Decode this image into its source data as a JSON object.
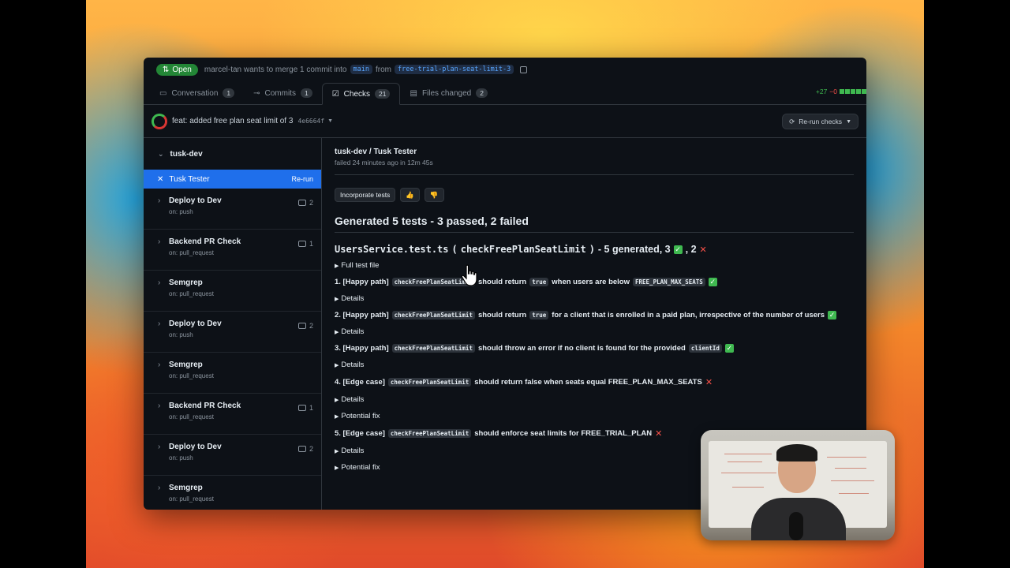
{
  "pr": {
    "state_label": "Open",
    "author": "marcel-tan",
    "merge_text": "wants to merge 1 commit into",
    "base_branch": "main",
    "from_text": "from",
    "head_branch": "free-trial-plan-seat-limit-3"
  },
  "tabs": [
    {
      "label": "Conversation",
      "count": "1",
      "icon": "comment-icon"
    },
    {
      "label": "Commits",
      "count": "1",
      "icon": "commit-icon"
    },
    {
      "label": "Checks",
      "count": "21",
      "icon": "checklist-icon"
    },
    {
      "label": "Files changed",
      "count": "2",
      "icon": "file-diff-icon"
    }
  ],
  "diffstat": {
    "additions": "+27",
    "deletions": "−0"
  },
  "commit": {
    "message": "feat: added free plan seat limit of 3",
    "sha": "4e6664f",
    "rerun_label": "Re-run checks"
  },
  "sidebar": {
    "group": "tusk-dev",
    "active_job": {
      "name": "Tusk Tester",
      "rerun": "Re-run"
    },
    "jobs": [
      {
        "name": "Deploy to Dev",
        "trigger": "on: push",
        "comments": "2"
      },
      {
        "name": "Backend PR Check",
        "trigger": "on: pull_request",
        "comments": "1"
      },
      {
        "name": "Semgrep",
        "trigger": "on: pull_request",
        "comments": ""
      },
      {
        "name": "Deploy to Dev",
        "trigger": "on: push",
        "comments": "2"
      },
      {
        "name": "Semgrep",
        "trigger": "on: pull_request",
        "comments": ""
      },
      {
        "name": "Backend PR Check",
        "trigger": "on: pull_request",
        "comments": "1"
      },
      {
        "name": "Deploy to Dev",
        "trigger": "on: push",
        "comments": "2"
      },
      {
        "name": "Semgrep",
        "trigger": "on: pull_request",
        "comments": ""
      }
    ]
  },
  "main": {
    "run_title": "tusk-dev / Tusk Tester",
    "run_status": "failed 24 minutes ago in 12m 45s",
    "incorporate_label": "Incorporate tests",
    "thumbs_up": "👍",
    "thumbs_down": "👎",
    "heading": "Generated 5 tests - 3 passed, 2 failed",
    "file_name": "UsersService.test.ts",
    "function_name": "checkFreePlanSeatLimit",
    "file_summary_a": "- 5 generated, 3",
    "file_summary_b": ", 2",
    "full_test_file": "Full test file",
    "details_label": "Details",
    "potential_fix_label": "Potential fix",
    "tests": {
      "t1": {
        "prefix": "1. [Happy path]",
        "fn": "checkFreePlanSeatLimit",
        "a": "should return",
        "code2": "true",
        "b": "when users are below",
        "code3": "FREE_PLAN_MAX_SEATS"
      },
      "t2": {
        "prefix": "2. [Happy path]",
        "fn": "checkFreePlanSeatLimit",
        "a": "should return",
        "code2": "true",
        "b": "for a client that is enrolled in a paid plan, irrespective of the number of users"
      },
      "t3": {
        "prefix": "3. [Happy path]",
        "fn": "checkFreePlanSeatLimit",
        "a": "should throw an error if no client is found for the provided",
        "code2": "clientId"
      },
      "t4": {
        "prefix": "4. [Edge case]",
        "fn": "checkFreePlanSeatLimit",
        "a": "should return false when seats equal FREE_PLAN_MAX_SEATS"
      },
      "t5": {
        "prefix": "5. [Edge case]",
        "fn": "checkFreePlanSeatLimit",
        "a": "should enforce seat limits for FREE_TRIAL_PLAN"
      }
    }
  }
}
